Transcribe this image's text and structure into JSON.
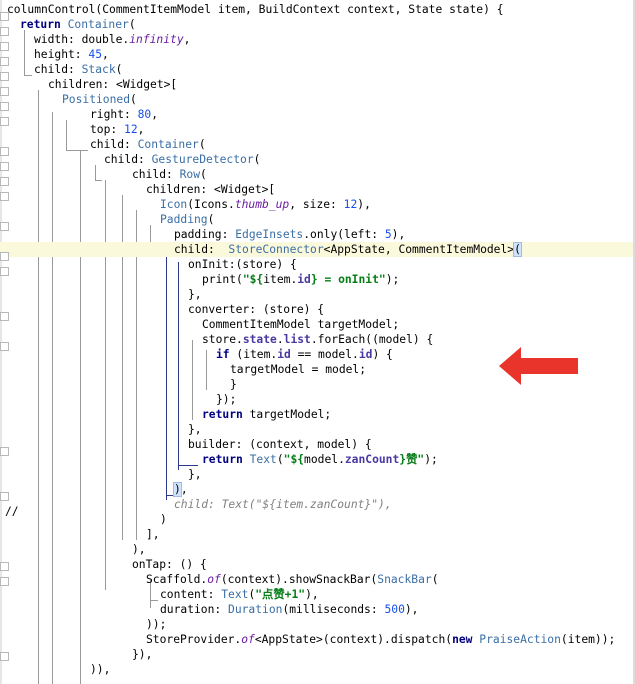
{
  "code": {
    "lines": [
      [
        {
          "t": "columnControl(CommentItemModel item, BuildContext context, State state) {",
          "c": ""
        }
      ],
      [
        {
          "t": "return ",
          "c": "k"
        },
        {
          "t": "Container",
          "c": "cls"
        },
        {
          "t": "(",
          "c": ""
        }
      ],
      [
        {
          "t": "width: double.",
          "c": ""
        },
        {
          "t": "infinity",
          "c": "it"
        },
        {
          "t": ",",
          "c": ""
        }
      ],
      [
        {
          "t": "height: ",
          "c": ""
        },
        {
          "t": "45",
          "c": "num"
        },
        {
          "t": ",",
          "c": ""
        }
      ],
      [
        {
          "t": "child: ",
          "c": ""
        },
        {
          "t": "Stack",
          "c": "cls"
        },
        {
          "t": "(",
          "c": ""
        }
      ],
      [
        {
          "t": "children: <Widget>[",
          "c": ""
        }
      ],
      [
        {
          "t": "Positioned",
          "c": "cls"
        },
        {
          "t": "(",
          "c": ""
        }
      ],
      [
        {
          "t": "right: ",
          "c": ""
        },
        {
          "t": "80",
          "c": "num"
        },
        {
          "t": ",",
          "c": ""
        }
      ],
      [
        {
          "t": "top: ",
          "c": ""
        },
        {
          "t": "12",
          "c": "num"
        },
        {
          "t": ",",
          "c": ""
        }
      ],
      [
        {
          "t": "child: ",
          "c": ""
        },
        {
          "t": "Container",
          "c": "cls"
        },
        {
          "t": "(",
          "c": ""
        }
      ],
      [
        {
          "t": "child: ",
          "c": ""
        },
        {
          "t": "GestureDetector",
          "c": "cls"
        },
        {
          "t": "(",
          "c": ""
        }
      ],
      [
        {
          "t": "child: ",
          "c": ""
        },
        {
          "t": "Row",
          "c": "cls"
        },
        {
          "t": "(",
          "c": ""
        }
      ],
      [
        {
          "t": "children: <Widget>[",
          "c": ""
        }
      ],
      [
        {
          "t": "Icon",
          "c": "cls"
        },
        {
          "t": "(Icons.",
          "c": ""
        },
        {
          "t": "thumb_up",
          "c": "it"
        },
        {
          "t": ", size: ",
          "c": ""
        },
        {
          "t": "12",
          "c": "num"
        },
        {
          "t": "),",
          "c": ""
        }
      ],
      [
        {
          "t": "Padding",
          "c": "cls"
        },
        {
          "t": "(",
          "c": ""
        }
      ],
      [
        {
          "t": "padding: ",
          "c": ""
        },
        {
          "t": "EdgeInsets",
          "c": "cls"
        },
        {
          "t": ".only(left: ",
          "c": ""
        },
        {
          "t": "5",
          "c": "num"
        },
        {
          "t": "),",
          "c": ""
        }
      ],
      [
        {
          "t": "child:  ",
          "c": ""
        },
        {
          "t": "StoreConnector",
          "c": "cls"
        },
        {
          "t": "<AppState, CommentItemModel>",
          "c": ""
        },
        {
          "t": "(",
          "c": "brk"
        }
      ],
      [
        {
          "t": "onInit:(store) {",
          "c": ""
        }
      ],
      [
        {
          "t": "print(",
          "c": ""
        },
        {
          "t": "\"${",
          "c": "str"
        },
        {
          "t": "item",
          "c": ""
        },
        {
          "t": ".",
          "c": ""
        },
        {
          "t": "id",
          "c": "fld"
        },
        {
          "t": "} = onInit\"",
          "c": "str"
        },
        {
          "t": ");",
          "c": ""
        }
      ],
      [
        {
          "t": "},",
          "c": ""
        }
      ],
      [
        {
          "t": "converter: (store) {",
          "c": ""
        }
      ],
      [
        {
          "t": "CommentItemModel targetModel;",
          "c": ""
        }
      ],
      [
        {
          "t": "store.",
          "c": ""
        },
        {
          "t": "state",
          "c": "fld"
        },
        {
          "t": ".",
          "c": ""
        },
        {
          "t": "list",
          "c": "fld"
        },
        {
          "t": ".forEach((model) {",
          "c": ""
        }
      ],
      [
        {
          "t": "if ",
          "c": "k"
        },
        {
          "t": "(item.",
          "c": ""
        },
        {
          "t": "id",
          "c": "fld"
        },
        {
          "t": " == model.",
          "c": ""
        },
        {
          "t": "id",
          "c": "fld"
        },
        {
          "t": ") {",
          "c": ""
        }
      ],
      [
        {
          "t": "targetModel = model;",
          "c": ""
        }
      ],
      [
        {
          "t": "}",
          "c": ""
        }
      ],
      [
        {
          "t": "});",
          "c": ""
        }
      ],
      [
        {
          "t": "return ",
          "c": "k"
        },
        {
          "t": "targetModel;",
          "c": ""
        }
      ],
      [
        {
          "t": "},",
          "c": ""
        }
      ],
      [
        {
          "t": "builder: (context, model) {",
          "c": ""
        }
      ],
      [
        {
          "t": "return ",
          "c": "k"
        },
        {
          "t": "Text",
          "c": "cls"
        },
        {
          "t": "(",
          "c": ""
        },
        {
          "t": "\"${",
          "c": "str"
        },
        {
          "t": "model",
          "c": ""
        },
        {
          "t": ".",
          "c": ""
        },
        {
          "t": "zanCount",
          "c": "fld"
        },
        {
          "t": "}赞\"",
          "c": "str"
        },
        {
          "t": ");",
          "c": ""
        }
      ],
      [
        {
          "t": "},",
          "c": ""
        }
      ],
      [
        {
          "t": ")",
          "c": "brk"
        },
        {
          "t": ",",
          "c": ""
        }
      ],
      [
        {
          "t": "child: Text(\"${item.zanCount}\"),",
          "c": "cm"
        }
      ],
      [
        {
          "t": ")",
          "c": ""
        }
      ],
      [
        {
          "t": "],",
          "c": ""
        }
      ],
      [
        {
          "t": "),",
          "c": ""
        }
      ],
      [
        {
          "t": "onTap: () {",
          "c": ""
        }
      ],
      [
        {
          "t": "Scaffold.",
          "c": ""
        },
        {
          "t": "of",
          "c": "it"
        },
        {
          "t": "(context).showSnackBar(",
          "c": ""
        },
        {
          "t": "SnackBar",
          "c": "cls"
        },
        {
          "t": "(",
          "c": ""
        }
      ],
      [
        {
          "t": "content: ",
          "c": ""
        },
        {
          "t": "Text",
          "c": "cls"
        },
        {
          "t": "(",
          "c": ""
        },
        {
          "t": "\"点赞+1\"",
          "c": "str"
        },
        {
          "t": "),",
          "c": ""
        }
      ],
      [
        {
          "t": "duration: ",
          "c": ""
        },
        {
          "t": "Duration",
          "c": "cls"
        },
        {
          "t": "(milliseconds: ",
          "c": ""
        },
        {
          "t": "500",
          "c": "num"
        },
        {
          "t": "),",
          "c": ""
        }
      ],
      [
        {
          "t": "));",
          "c": ""
        }
      ],
      [
        {
          "t": "StoreProvider.",
          "c": ""
        },
        {
          "t": "of",
          "c": "it"
        },
        {
          "t": "<AppState>(context).dispatch(",
          "c": ""
        },
        {
          "t": "new ",
          "c": "k"
        },
        {
          "t": "PraiseAction",
          "c": "cls"
        },
        {
          "t": "(item));",
          "c": ""
        }
      ],
      [
        {
          "t": "}),",
          "c": ""
        }
      ],
      [
        {
          "t": ")),",
          "c": ""
        }
      ]
    ],
    "comment_marker": "//"
  },
  "annotation": {
    "arrow_icon": "red-arrow-left-icon",
    "arrow_color": "#e8342b"
  },
  "colors": {
    "keyword": "#000080",
    "class": "#3a6ea5",
    "number": "#1750eb",
    "string": "#067d17",
    "comment": "#808080",
    "highlight_line": "#fbf9dc"
  }
}
